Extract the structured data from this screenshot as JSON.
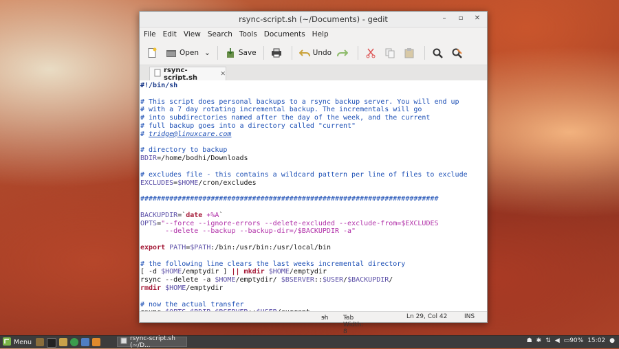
{
  "window": {
    "title": "rsync-script.sh (~/Documents) - gedit",
    "controls": [
      "–",
      "▫",
      "✕"
    ]
  },
  "menu": [
    "File",
    "Edit",
    "View",
    "Search",
    "Tools",
    "Documents",
    "Help"
  ],
  "toolbar": {
    "open_label": "Open",
    "save_label": "Save",
    "undo_label": "Undo"
  },
  "tab": {
    "label": "rsync-script.sh",
    "close": "✕"
  },
  "code": [
    [
      [
        "sh",
        "#!/bin/sh"
      ]
    ],
    [],
    [
      [
        "cm",
        "# This script does personal backups to a rsync backup server. You will end up"
      ]
    ],
    [
      [
        "cm",
        "# with a 7 day rotating incremental backup. The incrementals will go"
      ]
    ],
    [
      [
        "cm",
        "# into subdirectories named after the day of the week, and the current"
      ]
    ],
    [
      [
        "cm",
        "# full backup goes into a directory called \"current\""
      ]
    ],
    [
      [
        "cm",
        "# "
      ],
      [
        "ln",
        "tridge@linuxcare.com"
      ]
    ],
    [],
    [
      [
        "cm",
        "# directory to backup"
      ]
    ],
    [
      [
        "vr",
        "BDIR"
      ],
      [
        "t",
        "=/home/bodhi/Downloads"
      ]
    ],
    [],
    [
      [
        "cm",
        "# excludes file - this contains a wildcard pattern per line of files to exclude"
      ]
    ],
    [
      [
        "vr",
        "EXCLUDES"
      ],
      [
        "t",
        "="
      ],
      [
        "vr",
        "$HOME"
      ],
      [
        "t",
        "/cron/excludes"
      ]
    ],
    [],
    [
      [
        "cm",
        "########################################################################"
      ]
    ],
    [],
    [
      [
        "vr",
        "BACKUPDIR"
      ],
      [
        "t",
        "=`"
      ],
      [
        "kw",
        "date"
      ],
      [
        "st",
        " +%A"
      ],
      [
        "t",
        "`"
      ]
    ],
    [
      [
        "vr",
        "OPTS"
      ],
      [
        "t",
        "="
      ],
      [
        "st",
        "\"--force --ignore-errors --delete-excluded --exclude-from=$EXCLUDES"
      ]
    ],
    [
      [
        "st",
        "      --delete --backup --backup-dir=/$BACKUPDIR -a\""
      ]
    ],
    [],
    [
      [
        "kw",
        "export"
      ],
      [
        "t",
        " "
      ],
      [
        "vr",
        "PATH"
      ],
      [
        "t",
        "="
      ],
      [
        "vr",
        "$PATH"
      ],
      [
        "t",
        ":/bin:/usr/bin:/usr/local/bin"
      ]
    ],
    [],
    [
      [
        "cm",
        "# the following line clears the last weeks incremental directory"
      ]
    ],
    [
      [
        "t",
        "[ -d "
      ],
      [
        "vr",
        "$HOME"
      ],
      [
        "t",
        "/emptydir ] "
      ],
      [
        "kw",
        "||"
      ],
      [
        "t",
        " "
      ],
      [
        "kw",
        "mkdir"
      ],
      [
        "t",
        " "
      ],
      [
        "vr",
        "$HOME"
      ],
      [
        "t",
        "/emptydir"
      ]
    ],
    [
      [
        "t",
        "rsync --delete -a "
      ],
      [
        "vr",
        "$HOME"
      ],
      [
        "t",
        "/emptydir/ "
      ],
      [
        "vr",
        "$BSERVER"
      ],
      [
        "t",
        "::"
      ],
      [
        "vr",
        "$USER"
      ],
      [
        "t",
        "/"
      ],
      [
        "vr",
        "$BACKUPDIR"
      ],
      [
        "t",
        "/"
      ]
    ],
    [
      [
        "kw",
        "rmdir"
      ],
      [
        "t",
        " "
      ],
      [
        "vr",
        "$HOME"
      ],
      [
        "t",
        "/emptydir"
      ]
    ],
    [],
    [
      [
        "cm",
        "# now the actual transfer"
      ]
    ],
    [
      [
        "t",
        "rsync "
      ],
      [
        "vr",
        "$OPTS"
      ],
      [
        "t",
        " "
      ],
      [
        "vr",
        "$BDIR"
      ],
      [
        "t",
        " "
      ],
      [
        "vr",
        "$BSERVER"
      ],
      [
        "t",
        "::"
      ],
      [
        "vr",
        "$USER"
      ],
      [
        "t",
        "/current"
      ]
    ]
  ],
  "status": {
    "language": "sh",
    "tab_width": "Tab Width: 8",
    "position": "Ln 29, Col 42",
    "mode": "INS"
  },
  "taskbar": {
    "menu_label": "Menu",
    "task_label": "rsync-script.sh (~/D...",
    "battery": "90%",
    "clock": "15:02"
  },
  "colors": {
    "comment": "#1c4fb5",
    "keyword": "#a51c39",
    "variable": "#5b4fa7",
    "string": "#b130a8"
  }
}
